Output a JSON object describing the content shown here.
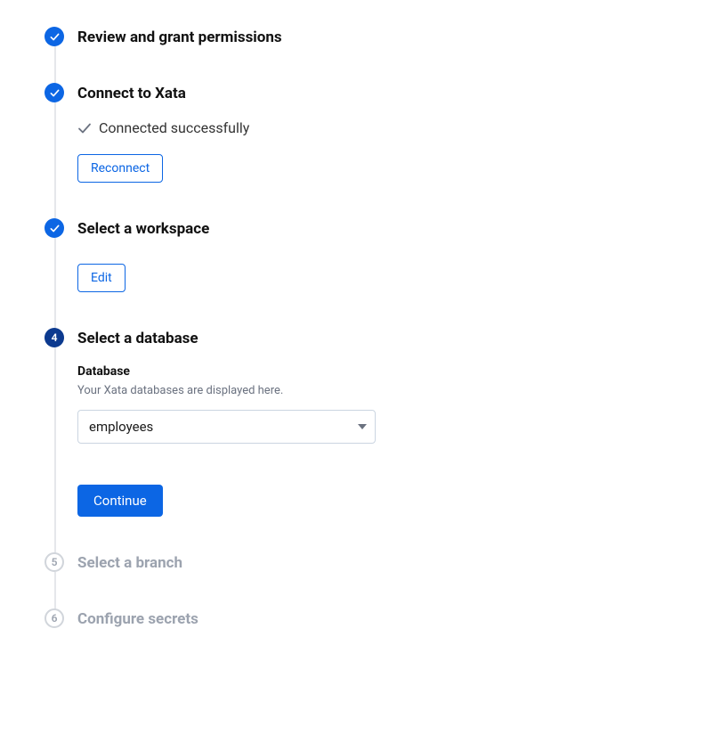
{
  "steps": {
    "s1": {
      "title": "Review and grant permissions"
    },
    "s2": {
      "title": "Connect to Xata",
      "status_text": "Connected successfully",
      "reconnect_label": "Reconnect"
    },
    "s3": {
      "title": "Select a workspace",
      "edit_label": "Edit"
    },
    "s4": {
      "number": "4",
      "title": "Select a database",
      "field_label": "Database",
      "field_help": "Your Xata databases are displayed here.",
      "selected_value": "employees",
      "continue_label": "Continue"
    },
    "s5": {
      "number": "5",
      "title": "Select a branch"
    },
    "s6": {
      "number": "6",
      "title": "Configure secrets"
    }
  }
}
